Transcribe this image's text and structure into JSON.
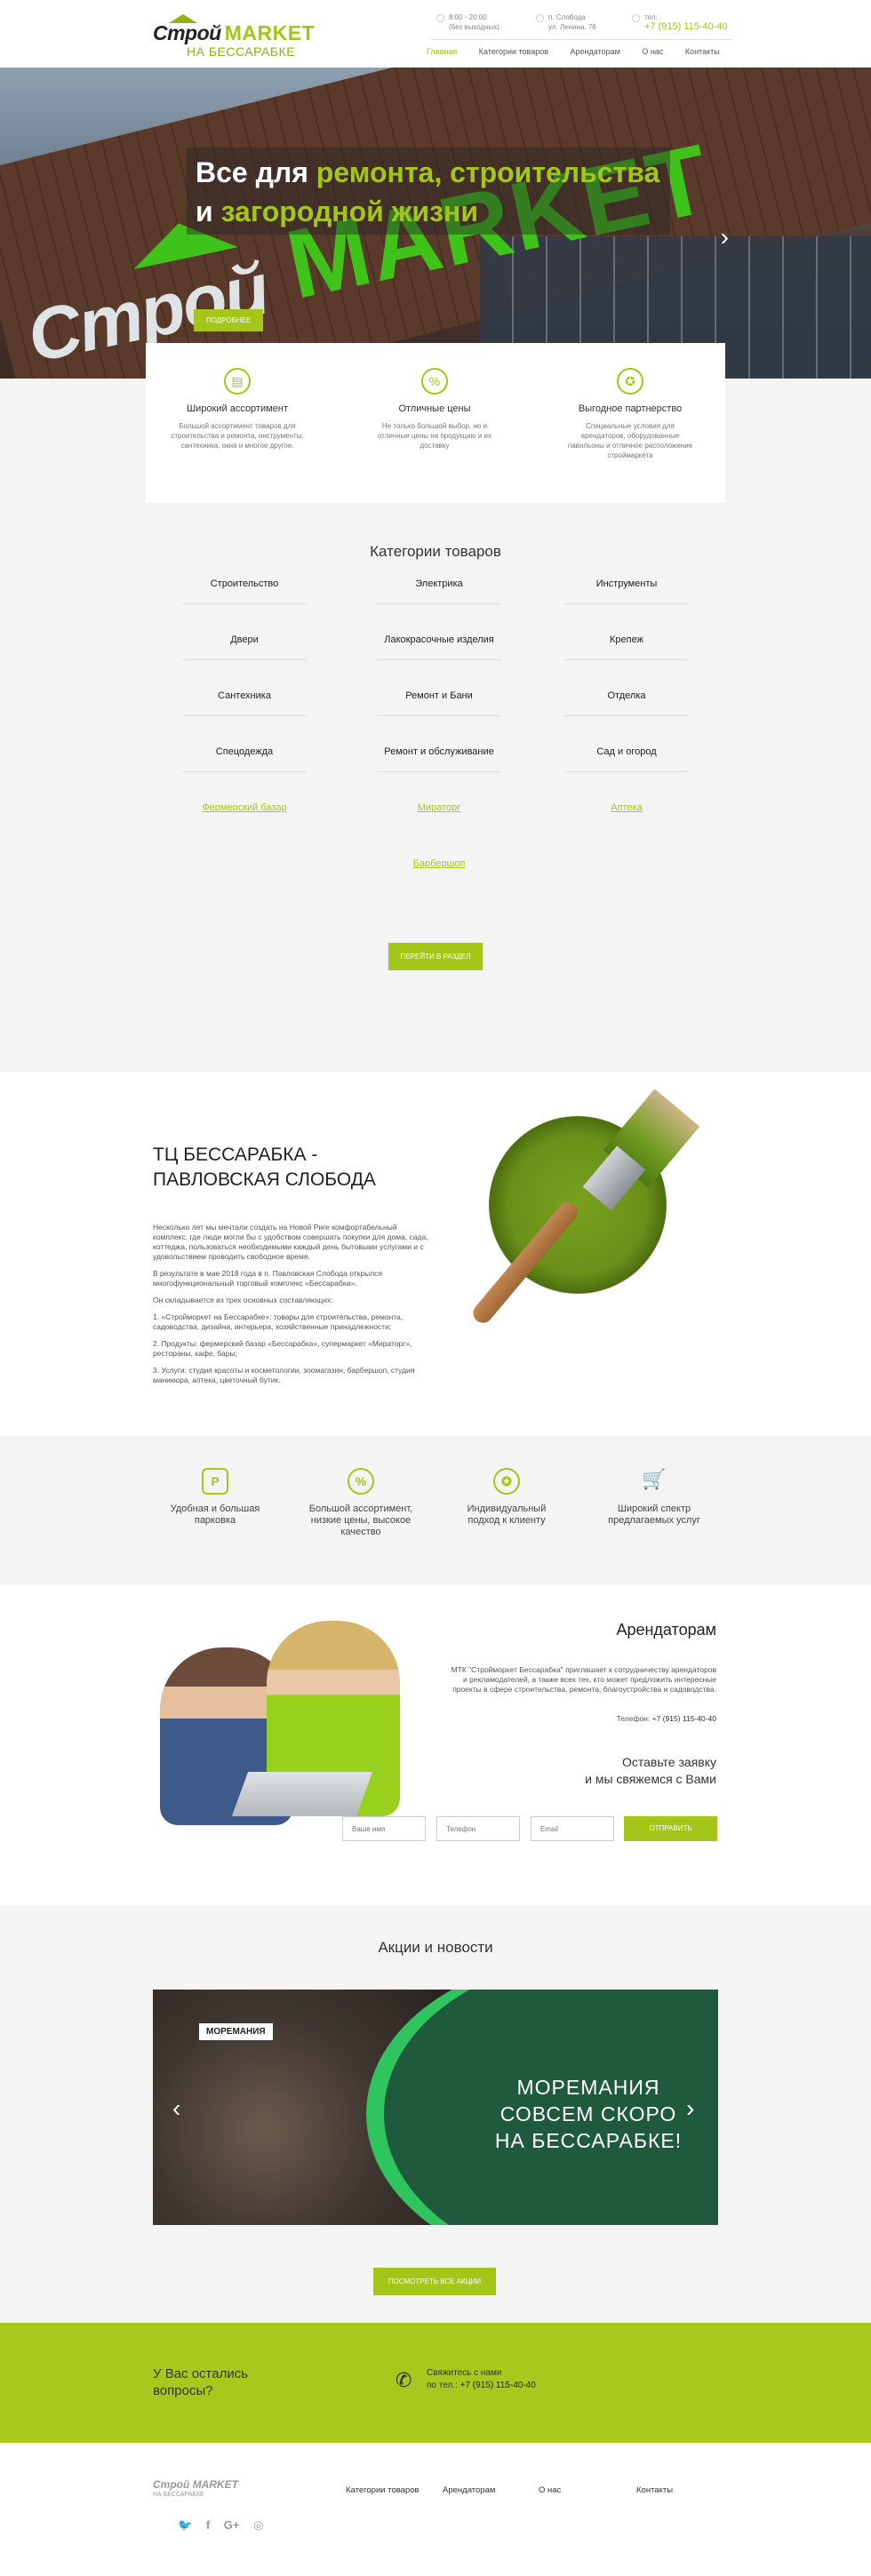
{
  "header": {
    "logo_top": "Строй",
    "logo_market": "MARKET",
    "logo_sub": "НА БЕССАРАБКЕ",
    "hours": "8:00 - 20:00",
    "hours_note": "(без выходных)",
    "address_line1": "п. Слобода",
    "address_line2": "ул. Ленина, 76",
    "phone_label": "тел:",
    "phone": "+7 (915) 115-40-40",
    "nav": [
      "Главная",
      "Категории товаров",
      "Арендаторам",
      "О нас",
      "Контакты"
    ]
  },
  "hero": {
    "title_a": "Все для ",
    "title_b": "ремонта, строительства",
    "title_c": "и ",
    "title_d": "загородной жизни",
    "button": "ПОДРОБНЕЕ",
    "sign_left": "Строй",
    "sign_right": "MARKET"
  },
  "features": [
    {
      "title": "Широкий ассортимент",
      "desc": "Большой ассортимент товаров для строительства и ремонта, инструменты, сантехника, окна и многое другое.",
      "icon": "wide-range-icon"
    },
    {
      "title": "Отличные цены",
      "desc": "Не только большой выбор, но и отличные цены на продукцию и их доставку",
      "icon": "discount-icon"
    },
    {
      "title": "Выгодное партнерство",
      "desc": "Специальные условия для арендаторов, оборудованные павильоны и отличное расположение строймаркета",
      "icon": "award-icon"
    }
  ],
  "categories": {
    "title": "Категории товаров",
    "items": [
      "Строительство",
      "Электрика",
      "Инструменты",
      "Двери",
      "Лакокрасочные изделия",
      "Крепеж",
      "Сантехника",
      "Ремонт и Бани",
      "Отделка",
      "Спецодежда",
      "Ремонт и обслуживание",
      "Сад и огород"
    ],
    "links": [
      "Фермерский базар",
      "Мираторг",
      "Аптека",
      "Барбершоп"
    ],
    "button": "ПЕРЕЙТИ В РАЗДЕЛ"
  },
  "about": {
    "title_line1": "ТЦ БЕССАРАБКА -",
    "title_line2": "ПАВЛОВСКАЯ СЛОБОДА",
    "p1": "Несколько лет мы мечтали создать на Новой Риге комфортабельный комплекс, где люди могли бы с удобством совершать покупки для дома, сада, коттеджа, пользоваться необходимыми каждый день бытовыми услугами и с удовольствием проводить свободное время.",
    "p2": "В результате в мае 2018 года в п. Павловская Слобода открылся многофункциональный торговый комплекс «Бессарабка».",
    "p3": "Он складывается из трех основных составляющих:",
    "li1": "1. «Стройморкет на Бессарабке»: товары для строительства, ремонта, садоводства, дизайна, интерьера, хозяйственные принадлежности;",
    "li2": "2. Продукты: фермерский базар «Бессарабка», супермаркет «Мираторг», рестораны, кафе, бары;",
    "li3": "3. Услуги: студия красоты и косметологии, зоомагазин, барбершоп, студия маникюра, аптека, цветочный бутик."
  },
  "advantages": [
    {
      "text": "Удобная и большая парковка",
      "icon": "parking-icon"
    },
    {
      "text": "Большой ассортимент, низкие цены, высокое качество",
      "icon": "discount-icon"
    },
    {
      "text": "Индивидуальный подход к клиенту",
      "icon": "medal-icon"
    },
    {
      "text": "Широкий спектр предлагаемых услуг",
      "icon": "cart-icon"
    }
  ],
  "tenants": {
    "title": "Арендаторам",
    "desc": "МТК \"Стройморкет Бессарабка\" приглашает к сотрудничеству арендаторов и рекламодателей, а также всех тех, кто может предложить интересные проекты в сфере строительства, ремонта, благоустройства и садоводства.",
    "tel_label": "Телефон:",
    "tel": "+7 (915) 115-40-40",
    "sub_line1": "Оставьте заявку",
    "sub_line2": "и мы свяжемся с Вами",
    "name_placeholder": "Ваше имя",
    "phone_placeholder": "Телефон",
    "email_placeholder": "Email",
    "send": "ОТПРАВИТЬ"
  },
  "news": {
    "title": "Акции и новости",
    "brand": "МОРЕМАНИЯ",
    "banner_line1": "МОРЕМАНИЯ",
    "banner_line2": "СОВСЕМ СКОРО",
    "banner_line3": "НА БЕССАРАБКЕ!",
    "button": "ПОСМОТРЕТЬ ВСЕ АКЦИИ"
  },
  "contact_bar": {
    "question_line1": "У Вас остались",
    "question_line2": "вопросы?",
    "call_line1": "Свяжитесь с нами",
    "call_prefix": "по тел.: ",
    "phone": "+7 (915) 115-40-40"
  },
  "footer": {
    "logo_top": "Строй MARKET",
    "logo_sub": "НА БЕССАРАБКЕ",
    "nav": [
      "Категории товаров",
      "Арендаторам",
      "О нас",
      "Контакты"
    ],
    "social": [
      "twitter-icon",
      "facebook-icon",
      "google-plus-icon",
      "instagram-icon"
    ]
  },
  "colors": {
    "accent": "#a4c51a",
    "bar": "#a7c91d",
    "gray_bg": "#f4f4f4"
  }
}
